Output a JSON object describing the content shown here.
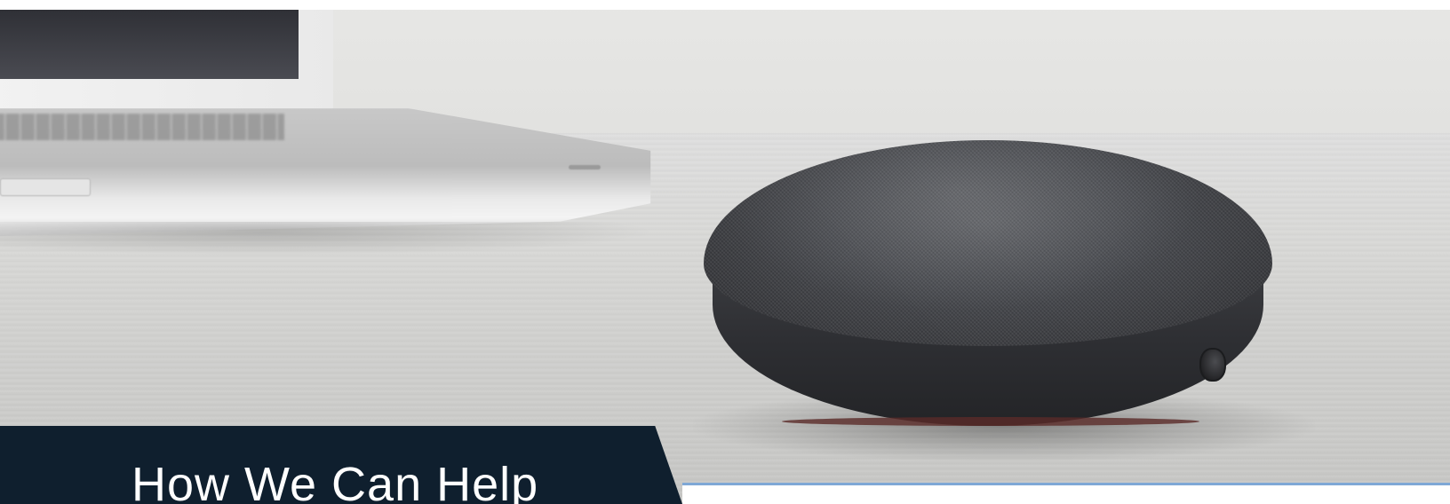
{
  "hero": {
    "image_description_icon": "smart-speaker-photo",
    "heading": "How We Can Help"
  },
  "colors": {
    "banner_background": "#0f1f2e",
    "heading_text": "#ffffff",
    "accent_line": "#7fa8d6"
  }
}
